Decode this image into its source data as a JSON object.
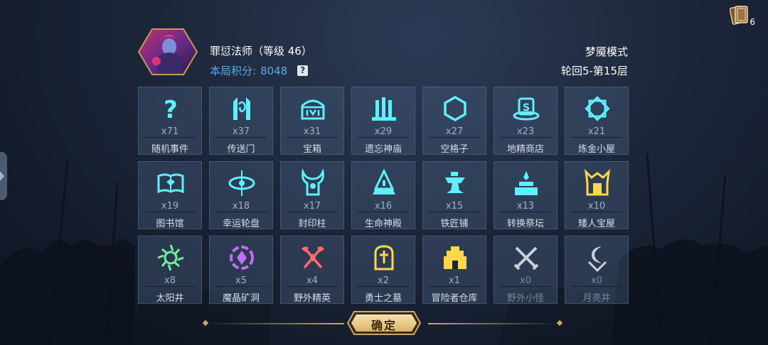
{
  "top_right": {
    "cards_icon": "card-deck-icon",
    "cards_count": "6"
  },
  "player": {
    "portrait_icon": "character-portrait",
    "name": "罪愆法师（等级 46）",
    "score_label": "本局积分:",
    "score_value": "8048",
    "help_label": "?"
  },
  "mode": {
    "name": "梦魇模式",
    "floor": "轮回5-第15层"
  },
  "colors": {
    "accent_blue": "#5fa8e8",
    "cyan_icon": "#5ff0ff",
    "gold_icon": "#ffd84a",
    "green_icon": "#6ef0a0",
    "purple_icon": "#c46cff",
    "red_icon": "#ff6b6b"
  },
  "events": [
    {
      "label": "随机事件",
      "count": "x71",
      "icon": "question-icon",
      "color": "#5ff0ff"
    },
    {
      "label": "传送门",
      "count": "x37",
      "icon": "portal-icon",
      "color": "#5ff0ff"
    },
    {
      "label": "宝箱",
      "count": "x31",
      "icon": "treasure-chest-icon",
      "color": "#5ff0ff"
    },
    {
      "label": "遗忘神庙",
      "count": "x29",
      "icon": "temple-icon",
      "color": "#5ff0ff"
    },
    {
      "label": "空格子",
      "count": "x27",
      "icon": "hexagon-icon",
      "color": "#5ff0ff"
    },
    {
      "label": "地精商店",
      "count": "x23",
      "icon": "shop-icon",
      "color": "#5ff0ff"
    },
    {
      "label": "炼金小屋",
      "count": "x21",
      "icon": "alchemy-icon",
      "color": "#5ff0ff"
    },
    {
      "label": "图书馆",
      "count": "x19",
      "icon": "book-icon",
      "color": "#5ff0ff"
    },
    {
      "label": "幸运轮盘",
      "count": "x18",
      "icon": "roulette-icon",
      "color": "#5ff0ff"
    },
    {
      "label": "封印柱",
      "count": "x17",
      "icon": "seal-pillar-icon",
      "color": "#5ff0ff"
    },
    {
      "label": "生命神殿",
      "count": "x16",
      "icon": "life-shrine-icon",
      "color": "#5ff0ff"
    },
    {
      "label": "铁匠铺",
      "count": "x15",
      "icon": "anvil-icon",
      "color": "#5ff0ff"
    },
    {
      "label": "转换祭坛",
      "count": "x13",
      "icon": "altar-icon",
      "color": "#5ff0ff"
    },
    {
      "label": "矮人宝屋",
      "count": "x10",
      "icon": "dwarf-house-icon",
      "color": "#ffd84a"
    },
    {
      "label": "太阳井",
      "count": "x8",
      "icon": "sun-well-icon",
      "color": "#6ef0a0"
    },
    {
      "label": "魔晶矿洞",
      "count": "x5",
      "icon": "crystal-mine-icon",
      "color": "#c46cff"
    },
    {
      "label": "野外精英",
      "count": "x4",
      "icon": "crossed-axes-icon",
      "color": "#ff6b6b"
    },
    {
      "label": "勇士之墓",
      "count": "x2",
      "icon": "tomb-icon",
      "color": "#ffd84a"
    },
    {
      "label": "冒险者仓库",
      "count": "x1",
      "icon": "warehouse-icon",
      "color": "#ffd84a"
    },
    {
      "label": "野外小怪",
      "count": "x0",
      "icon": "crossed-swords-icon",
      "color": "#c8d0da"
    },
    {
      "label": "月亮井",
      "count": "x0",
      "icon": "moon-well-icon",
      "color": "#c8d0da"
    }
  ],
  "confirm_label": "确定"
}
